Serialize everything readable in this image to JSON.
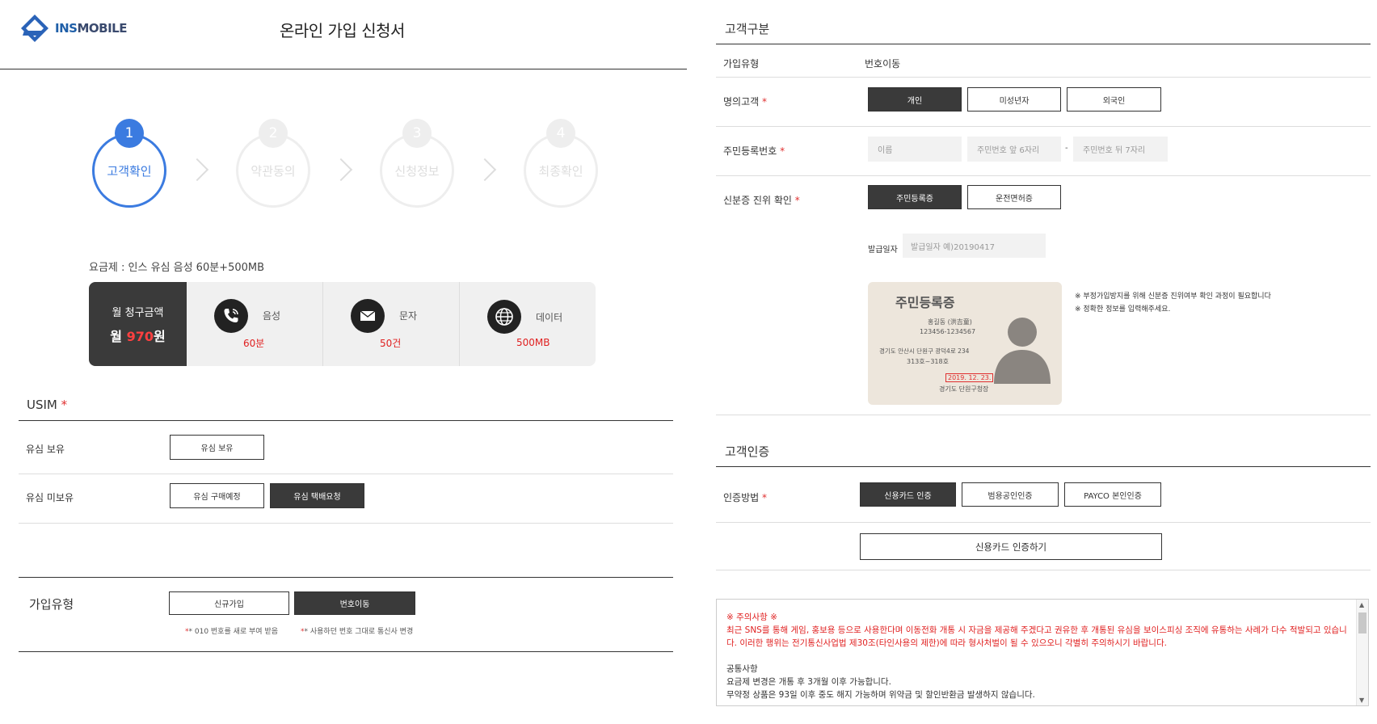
{
  "header": {
    "logo_text": "INS",
    "logo_sub": "MOBILE",
    "logo_badge": "INS",
    "page_title": "온라인 가입 신청서"
  },
  "steps": [
    {
      "num": "1",
      "label": "고객확인",
      "active": true
    },
    {
      "num": "2",
      "label": "약관동의",
      "active": false
    },
    {
      "num": "3",
      "label": "신청정보",
      "active": false
    },
    {
      "num": "4",
      "label": "최종확인",
      "active": false
    }
  ],
  "plan": {
    "label": "요금제 : 인스 유심 음성 60분+500MB",
    "bill_label": "월 청구금액",
    "bill_prefix": "월 ",
    "bill_amount": "970",
    "bill_suffix": "원",
    "items": [
      {
        "icon": "phone-icon",
        "name": "음성",
        "value": "60분"
      },
      {
        "icon": "mail-icon",
        "name": "문자",
        "value": "50건"
      },
      {
        "icon": "globe-icon",
        "name": "데이터",
        "value": "500MB"
      }
    ]
  },
  "usim": {
    "title": "USIM",
    "required": "*",
    "rows": [
      {
        "label": "유심 보유",
        "buttons": [
          {
            "label": "유심 보유",
            "selected": false
          }
        ]
      },
      {
        "label": "유심 미보유",
        "buttons": [
          {
            "label": "유심 구매예정",
            "selected": false
          },
          {
            "label": "유심 택배요청",
            "selected": true
          }
        ]
      }
    ]
  },
  "join_type": {
    "label": "가입유형",
    "buttons": [
      {
        "label": "신규가입",
        "selected": false
      },
      {
        "label": "번호이동",
        "selected": true
      }
    ],
    "notes": [
      "* 010 번호를 새로 부여 받음",
      "* 사용하던 번호 그대로 통신사 변경"
    ]
  },
  "customer": {
    "title": "고객구분",
    "join_type_label": "가입유형",
    "join_type_value": "번호이동",
    "holder_label": "명의고객",
    "holder_options": [
      {
        "label": "개인",
        "selected": true
      },
      {
        "label": "미성년자",
        "selected": false
      },
      {
        "label": "외국인",
        "selected": false
      }
    ],
    "rrn_label": "주민등록번호",
    "name_placeholder": "이름",
    "rrn_front_placeholder": "주민번호 앞 6자리",
    "rrn_dash": "-",
    "rrn_back_placeholder": "주민번호 뒤 7자리",
    "id_verify_label": "신분증 진위 확인",
    "id_options": [
      {
        "label": "주민등록증",
        "selected": true
      },
      {
        "label": "운전면허증",
        "selected": false
      }
    ],
    "issue_date_label": "발급일자",
    "issue_date_placeholder": "발급일자 예)20190417",
    "id_card": {
      "title": "주민등록증",
      "name": "홍길동 (洪吉童)",
      "number": "123456-1234567",
      "address1": "경기도 안산시 단원구 광덕4로 234",
      "address2": "313호~318호",
      "date": "2019. 12. 23.",
      "issuer": "경기도 단원구청장"
    },
    "id_notes": [
      "※ 부정가입방지를 위해 신분증 진위여부 확인 과정이 필요합니다",
      "※ 정확한 정보를 입력해주세요."
    ]
  },
  "auth": {
    "title": "고객인증",
    "method_label": "인증방법",
    "methods": [
      {
        "label": "신용카드 인증",
        "selected": true
      },
      {
        "label": "범용공인인증",
        "selected": false
      },
      {
        "label": "PAYCO 본인인증",
        "selected": false
      }
    ],
    "submit_label": "신용카드 인증하기"
  },
  "notice": {
    "warn_title": "※ 주의사항 ※",
    "warn_body": "최근 SNS를 통해 게임, 홍보용 등으로 사용한다며 이동전화 개통 시 자금을 제공해 주겠다고 권유한 후 개통된 유심을 보이스피싱 조직에 유통하는 사례가 다수 적발되고 있습니다. 이러한 행위는 전기통신사업법 제30조(타인사용의 제한)에 따라 형사처벌이 될 수 있으오니 각별히 주의하시기 바랍니다.",
    "common_title": "공통사항",
    "common_lines": [
      "요금제 변경은 개통 후 3개월 이후 가능합니다.",
      "무약정 상품은 93일 이후 중도 해지 가능하며 위약금 및 할인반환금 발생하지 않습니다."
    ]
  },
  "colors": {
    "accent": "#3b7be0",
    "dark_button": "#3a3a3a",
    "required": "#e03030",
    "price": "#e02020"
  }
}
